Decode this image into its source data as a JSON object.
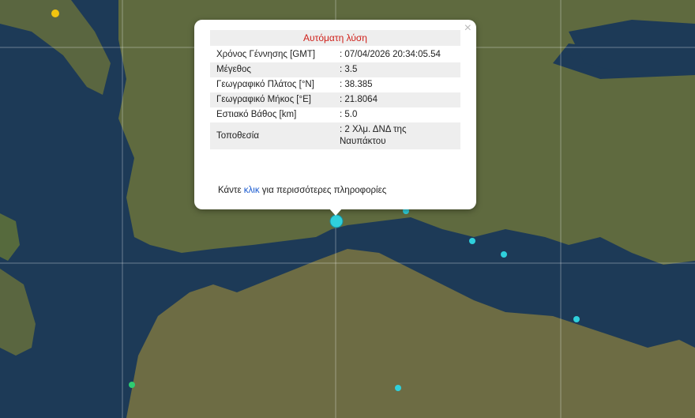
{
  "popup": {
    "title": "Αυτόματη λύση",
    "close": "×",
    "rows": [
      {
        "label": "Χρόνος Γέννησης [GMT]",
        "value": ": 07/04/2026 20:34:05.54"
      },
      {
        "label": "Μέγεθος",
        "value": ": 3.5"
      },
      {
        "label": "Γεωγραφικό Πλάτος [°N]",
        "value": ": 38.385"
      },
      {
        "label": "Γεωγραφικό Μήκος [°E]",
        "value": ": 21.8064"
      },
      {
        "label": "Εστιακό Βάθος [km]",
        "value": ": 5.0"
      },
      {
        "label": "Τοποθεσία",
        "value": ": 2 Χλμ. ΔΝΔ της Ναυπάκτου"
      }
    ],
    "more_prefix": "Κάντε ",
    "more_link": "κλικ",
    "more_suffix": " για περισσότερες πληροφορίες"
  },
  "colors": {
    "sea": "#1d3a57",
    "land": "#6a6d45",
    "marker_cyan": "#2fd0dc",
    "marker_yellow": "#f1c40f",
    "marker_green": "#2ecc71",
    "title_red": "#d0201a"
  }
}
